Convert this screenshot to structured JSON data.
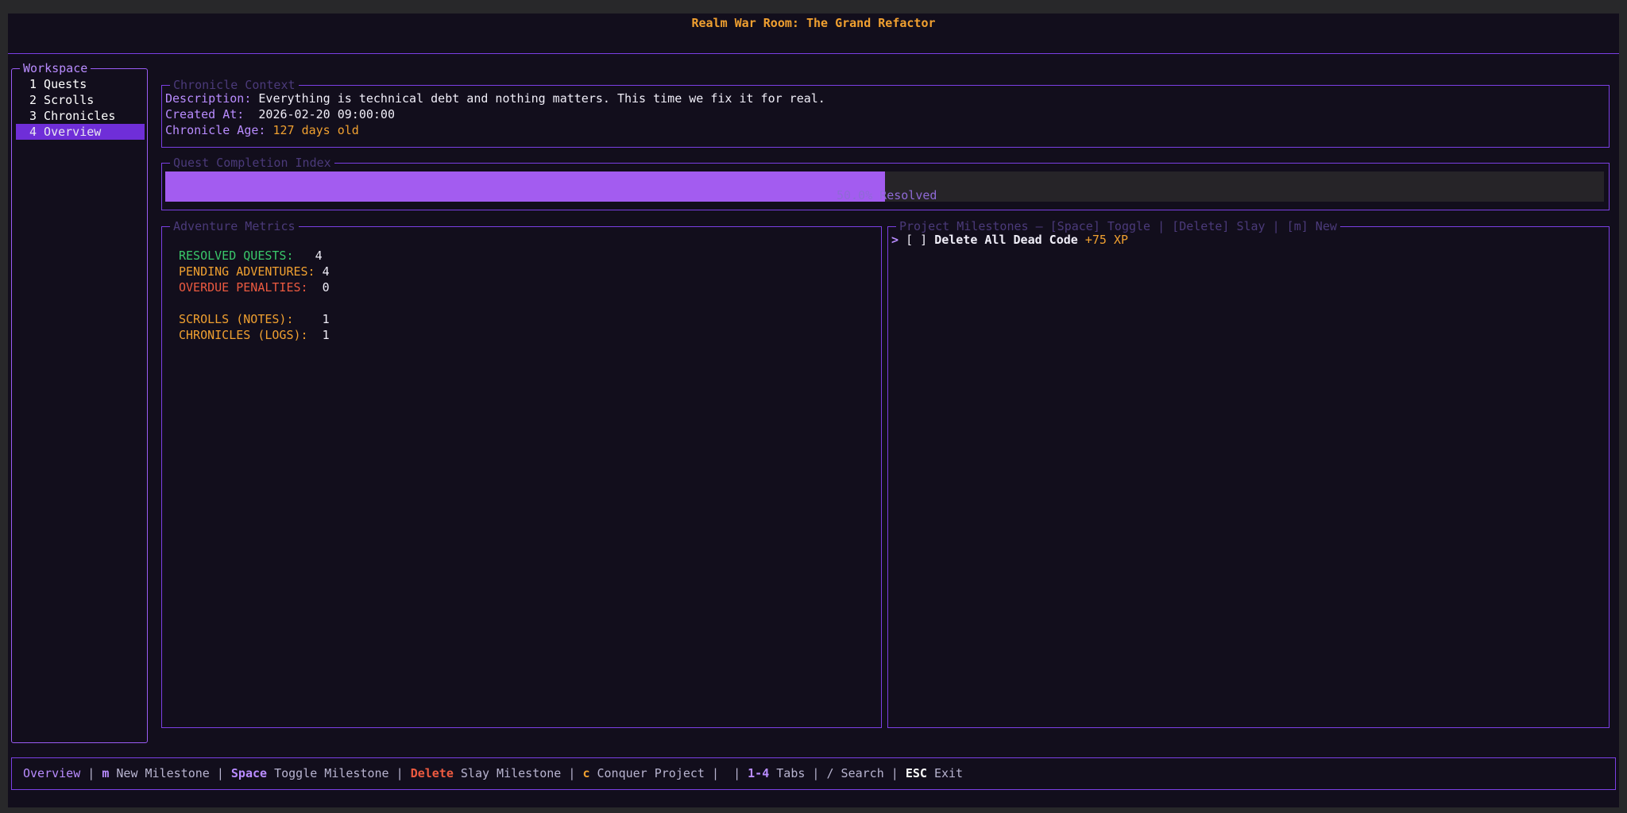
{
  "header": {
    "title": "Realm War Room: The Grand Refactor"
  },
  "sidebar": {
    "title": "Workspace",
    "items": [
      {
        "label": "1 Quests"
      },
      {
        "label": "2 Scrolls"
      },
      {
        "label": "3 Chronicles"
      },
      {
        "label": "4 Overview",
        "active": true
      }
    ]
  },
  "chronicle": {
    "title": "Chronicle Context",
    "description_label": "Description:",
    "description_value": "Everything is technical debt and nothing matters. This time we fix it for real.",
    "created_label": "Created At:",
    "created_value": "2026-02-20 09:00:00",
    "age_label": "Chronicle Age:",
    "age_value": "127 days old"
  },
  "progress": {
    "title": "Quest Completion Index",
    "fraction": 0.5,
    "text": "50.0% Resolved"
  },
  "metrics": {
    "title": "Adventure Metrics",
    "resolved_label": "RESOLVED QUESTS:",
    "resolved_value": "4",
    "pending_label": "PENDING ADVENTURES:",
    "pending_value": "4",
    "overdue_label": "OVERDUE PENALTIES:",
    "overdue_value": "0",
    "scrolls_label": "SCROLLS (NOTES):",
    "scrolls_value": "1",
    "chronicles_label": "CHRONICLES (LOGS):",
    "chronicles_value": "1"
  },
  "milestones": {
    "title": "Project Milestones — [Space] Toggle | [Delete] Slay | [m] New",
    "items": [
      {
        "cursor": ">",
        "checkbox": "[ ]",
        "name": "Delete All Dead Code",
        "xp": "+75 XP"
      }
    ]
  },
  "statusbar": {
    "mode": "Overview",
    "sep": " | ",
    "k1": "m",
    "a1": " New Milestone",
    "k2": "Space",
    "a2": " Toggle Milestone",
    "k3": "Delete",
    "a3": " Slay Milestone",
    "k4": "c",
    "a4": " Conquer Project",
    "k5": "1-4",
    "a5": " Tabs",
    "search": "/ Search",
    "k6": "ESC",
    "a6": " Exit"
  },
  "colors": {
    "accent": "#7b3fe4",
    "progress_fill": "#a35cf0",
    "orange": "#f0a030",
    "green": "#3ac86a",
    "red": "#ec5a40"
  }
}
